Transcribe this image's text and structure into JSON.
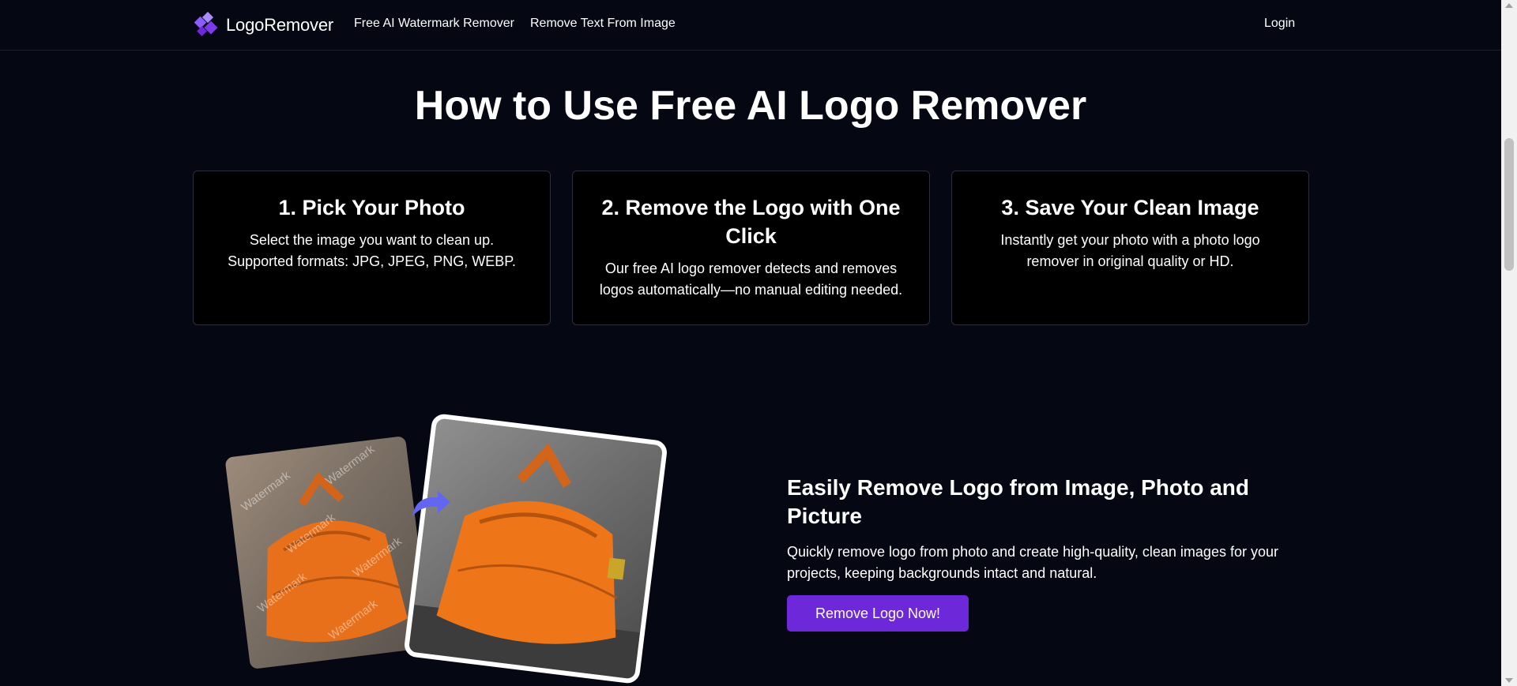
{
  "header": {
    "brand_name": "LogoRemover",
    "brand_icon": "logo-diamond-icon",
    "nav": [
      {
        "label": "Free AI Watermark Remover"
      },
      {
        "label": "Remove Text From Image"
      }
    ],
    "login_label": "Login"
  },
  "main": {
    "headline": "How to Use Free AI Logo Remover",
    "steps": [
      {
        "title": "1. Pick Your Photo",
        "description": "Select the image you want to clean up. Supported formats: JPG, JPEG, PNG, WEBP."
      },
      {
        "title": "2. Remove the Logo with One Click",
        "description": "Our free AI logo remover detects and removes logos automatically—no manual editing needed."
      },
      {
        "title": "3. Save Your Clean Image",
        "description": "Instantly get your photo with a photo logo remover in original quality or HD."
      }
    ],
    "feature": {
      "title": "Easily Remove Logo from Image, Photo and Picture",
      "description": "Quickly remove logo from photo and create high-quality, clean images for your projects, keeping backgrounds intact and natural.",
      "cta_label": "Remove Logo Now!",
      "watermark_text": "Watermark"
    }
  },
  "colors": {
    "background": "#050813",
    "accent": "#6d28d9",
    "brand_icon": "#8b5cf6",
    "bag_orange": "#e8701a"
  }
}
